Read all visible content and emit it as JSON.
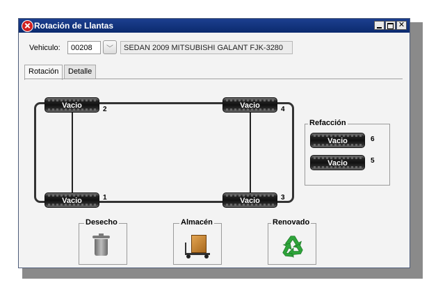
{
  "window": {
    "title": "Rotación de Llantas"
  },
  "vehicle": {
    "label": "Vehiculo:",
    "code": "00208",
    "description": "SEDAN 2009 MITSUBISHI GALANT FJK-3280"
  },
  "tabs": [
    "Rotación",
    "Detalle"
  ],
  "tires": [
    {
      "label": "Vacio",
      "number": "2"
    },
    {
      "label": "Vacio",
      "number": "4"
    },
    {
      "label": "Vacio",
      "number": "1"
    },
    {
      "label": "Vacio",
      "number": "3"
    }
  ],
  "refaccion": {
    "title": "Refacción",
    "tires": [
      {
        "label": "Vacio",
        "number": "6"
      },
      {
        "label": "Vacio",
        "number": "5"
      }
    ]
  },
  "bins": [
    {
      "title": "Desecho",
      "icon": "trash-can-icon"
    },
    {
      "title": "Almacén",
      "icon": "warehouse-cart-icon"
    },
    {
      "title": "Renovado",
      "icon": "recycle-icon"
    }
  ],
  "colors": {
    "titlebar": "#0b2a6e",
    "recycle": "#2ea43a"
  }
}
